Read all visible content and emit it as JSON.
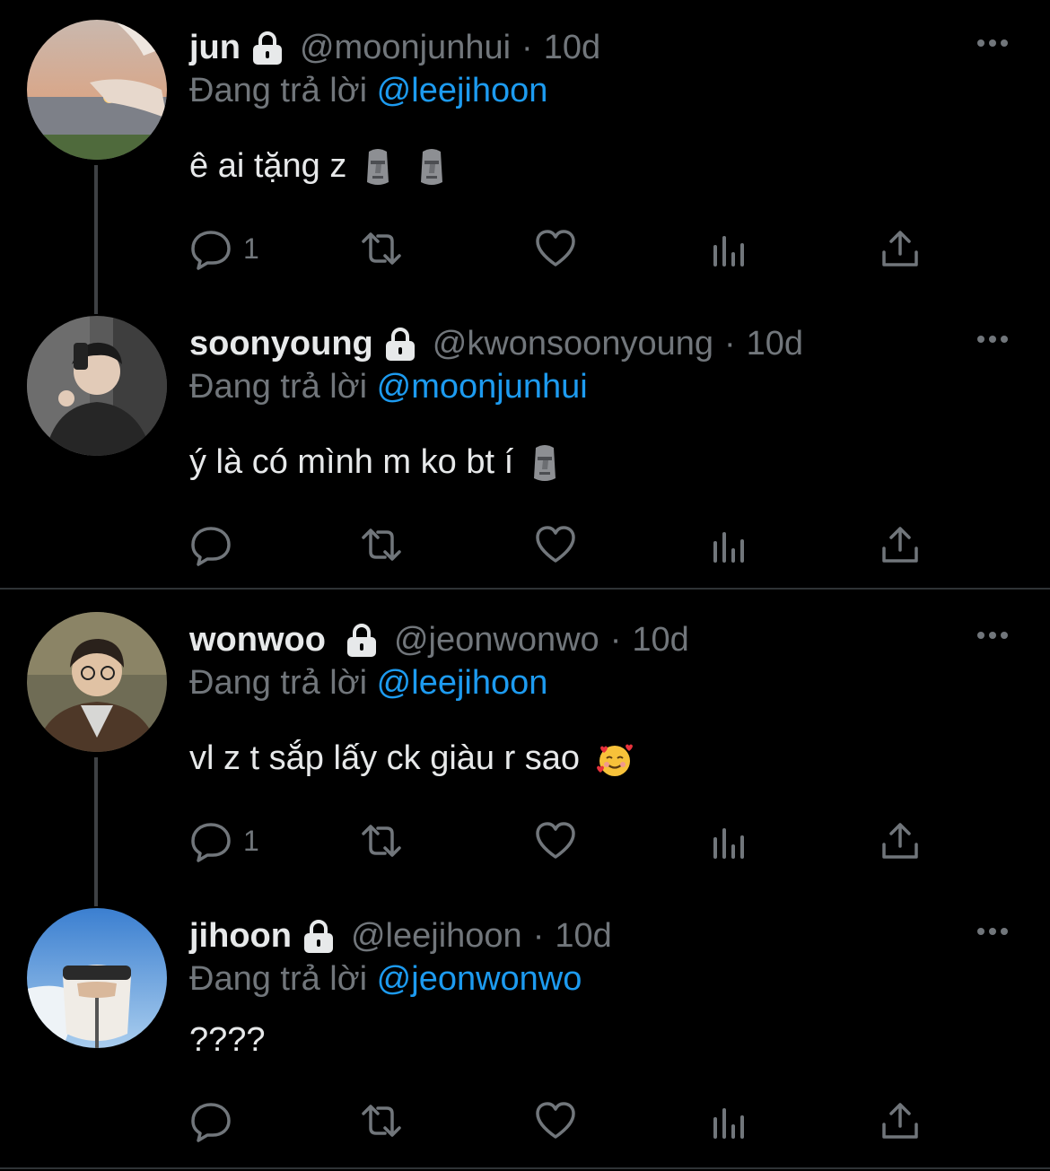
{
  "reply_prefix": "Đang trả lời",
  "tweets": [
    {
      "name": "jun",
      "handle": "@moonjunhui",
      "time": "10d",
      "reply_to": "@leejihoon",
      "text": "ê ai tặng z",
      "emoji": [
        "moai-emoji",
        "moai-emoji"
      ],
      "reply_count": "1",
      "avatar": "sunset-avatar"
    },
    {
      "name": "soonyoung",
      "handle": "@kwonsoonyoung",
      "time": "10d",
      "reply_to": "@moonjunhui",
      "text": "ý là có mình m ko bt í",
      "emoji": [
        "moai-emoji"
      ],
      "reply_count": "",
      "avatar": "mirror-selfie-avatar"
    },
    {
      "name": "wonwoo",
      "handle": "@jeonwonwo",
      "time": "10d",
      "reply_to": "@leejihoon",
      "text": "vl z t sắp lấy ck giàu r sao",
      "emoji": [
        "smiling-face-with-hearts-emoji"
      ],
      "reply_count": "1",
      "avatar": "glasses-man-avatar"
    },
    {
      "name": "jihoon",
      "handle": "@leejihoon",
      "time": "10d",
      "reply_to": "@jeonwonwo",
      "text": "????",
      "emoji": [],
      "reply_count": "",
      "avatar": "sky-headband-avatar"
    }
  ],
  "colors": {
    "background": "#000000",
    "text": "#e7e9ea",
    "muted": "#71767b",
    "mention": "#1d9bf0",
    "thread_line": "#3e4144"
  }
}
